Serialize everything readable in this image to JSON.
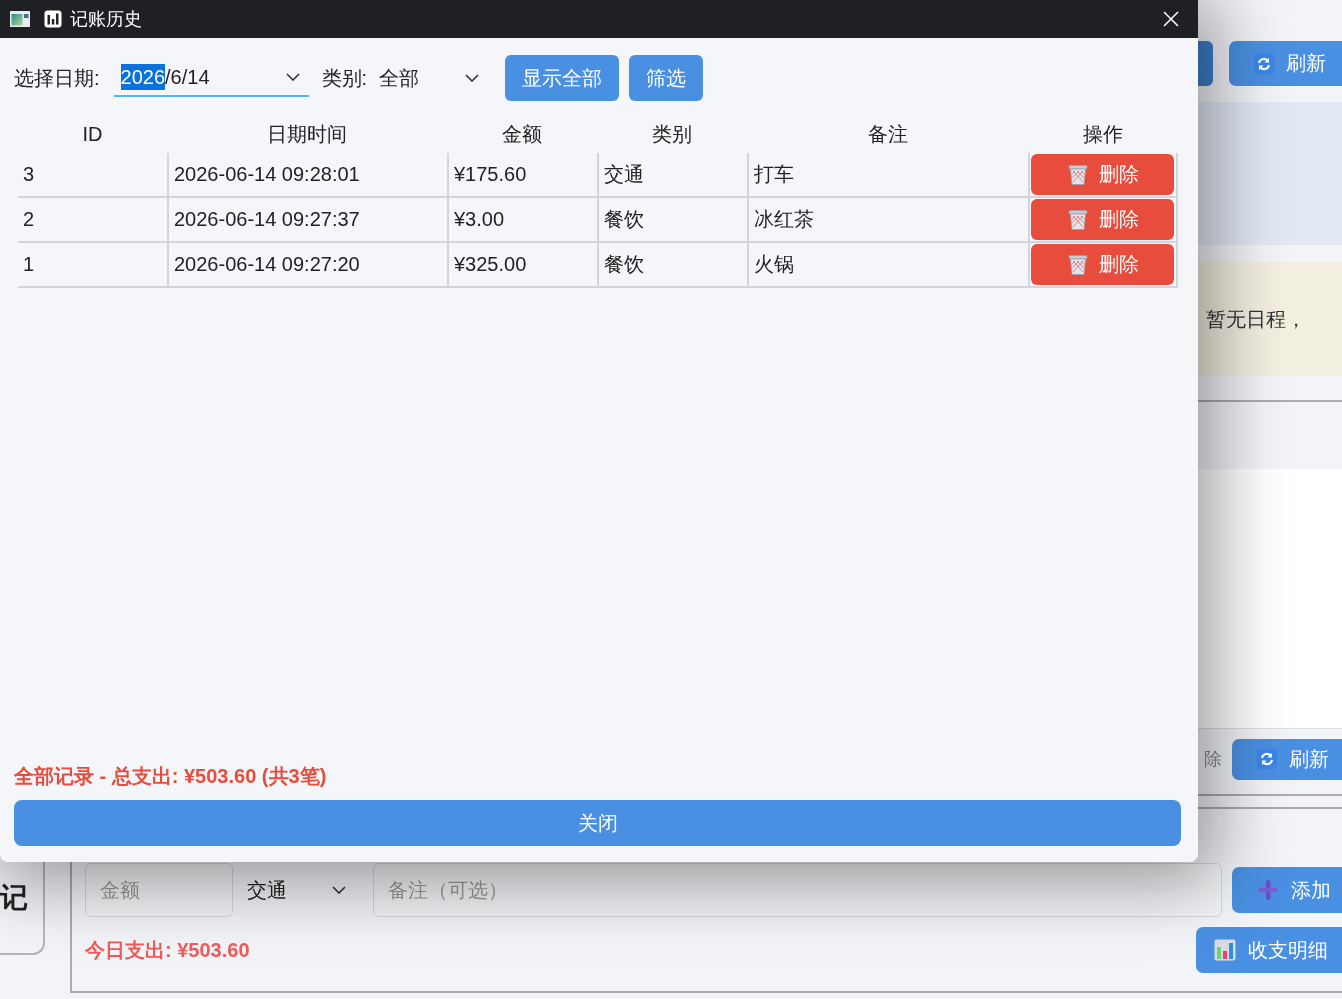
{
  "dialog": {
    "title": "记账历史",
    "filters": {
      "date_label": "选择日期:",
      "date_value": [
        {
          "text": "2026",
          "selected": true
        },
        {
          "text": "/6/14",
          "selected": false
        }
      ],
      "category_label": "类别:",
      "category_value": "全部",
      "buttons": [
        "显示全部",
        "筛选"
      ]
    },
    "table": {
      "columns": [
        "ID",
        "日期时间",
        "金额",
        "类别",
        "备注",
        "操作"
      ],
      "rows": [
        {
          "cells": [
            "3",
            "2026-06-14 09:28:01",
            "¥175.60",
            "交通",
            "打车"
          ],
          "action": "删除"
        },
        {
          "cells": [
            "2",
            "2026-06-14 09:27:37",
            "¥3.00",
            "餐饮",
            "冰红茶"
          ],
          "action": "删除"
        },
        {
          "cells": [
            "1",
            "2026-06-14 09:27:20",
            "¥325.00",
            "餐饮",
            "火锅"
          ],
          "action": "删除"
        }
      ]
    },
    "summary": "全部记录 - 总支出: ¥503.60 (共3笔)",
    "close_button": "关闭"
  },
  "background_app": {
    "refresh_button": "刷新",
    "schedule_text": "暂无日程，",
    "list_footer": {
      "text": "除",
      "refresh_button": "刷新"
    },
    "quick_add": {
      "side_card_text": "记",
      "amount_field": {
        "placeholder": "金额"
      },
      "category_select": {
        "value": "交通"
      },
      "note_field": {
        "placeholder": "备注（可选）"
      },
      "add_button": "添加",
      "today_total": "今日支出: ¥503.60",
      "details_button": "收支明细"
    }
  }
}
